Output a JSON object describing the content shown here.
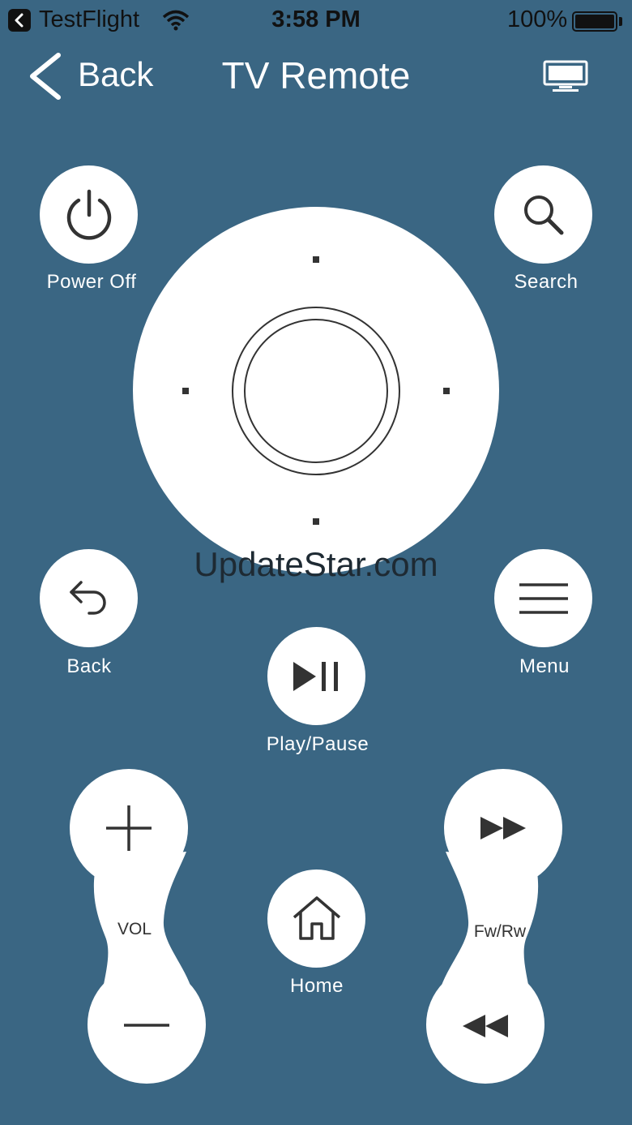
{
  "status_bar": {
    "carrier": "TestFlight",
    "time": "3:58 PM",
    "battery": "100%"
  },
  "nav": {
    "back_label": "Back",
    "title": "TV Remote"
  },
  "buttons": {
    "power_label": "Power Off",
    "search_label": "Search",
    "back_label": "Back",
    "menu_label": "Menu",
    "play_pause_label": "Play/Pause",
    "home_label": "Home",
    "vol_label": "VOL",
    "fw_rw_label": "Fw/Rw"
  },
  "watermark": "UpdateStar.com",
  "colors": {
    "background": "#3a6683",
    "button": "#ffffff",
    "icon": "#333333"
  }
}
